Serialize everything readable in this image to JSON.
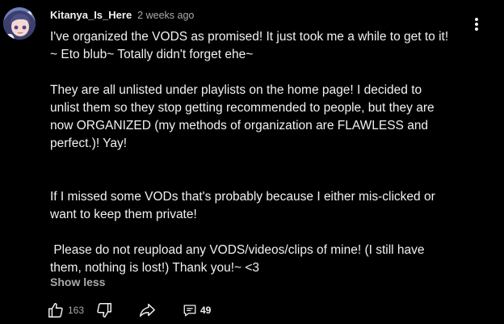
{
  "comment": {
    "author": "Kitanya_Is_Here",
    "timestamp": "2 weeks ago",
    "text": "I've organized the VODS as promised! It just took me a while to get to it!\n~ Eto blub~ Totally didn't forget ehe~\n\nThey are all unlisted under playlists on the home page! I decided to\nunlist them so they stop getting recommended to people, but they are\nnow ORGANIZED (my methods of organization are FLAWLESS and\nperfect.)! Yay!\n\n\nIf I missed some VODs that's probably because I either mis-clicked or\nwant to keep them private!\n\n Please do not reupload any VODS/videos/clips of mine! (I still have\nthem, nothing is lost!) Thank you!~ <3",
    "show_less_label": "Show less"
  },
  "actions": {
    "like_count": "163",
    "reply_count": "49"
  },
  "icons": {
    "avatar": "avatar-anime-character",
    "menu": "kebab-menu-icon",
    "like": "thumbs-up-icon",
    "dislike": "thumbs-down-icon",
    "share": "share-arrow-icon",
    "replies": "comment-bubble-icon"
  },
  "colors": {
    "background": "#000000",
    "primary_text": "#f1f1f1",
    "secondary_text": "#aaaaaa"
  }
}
